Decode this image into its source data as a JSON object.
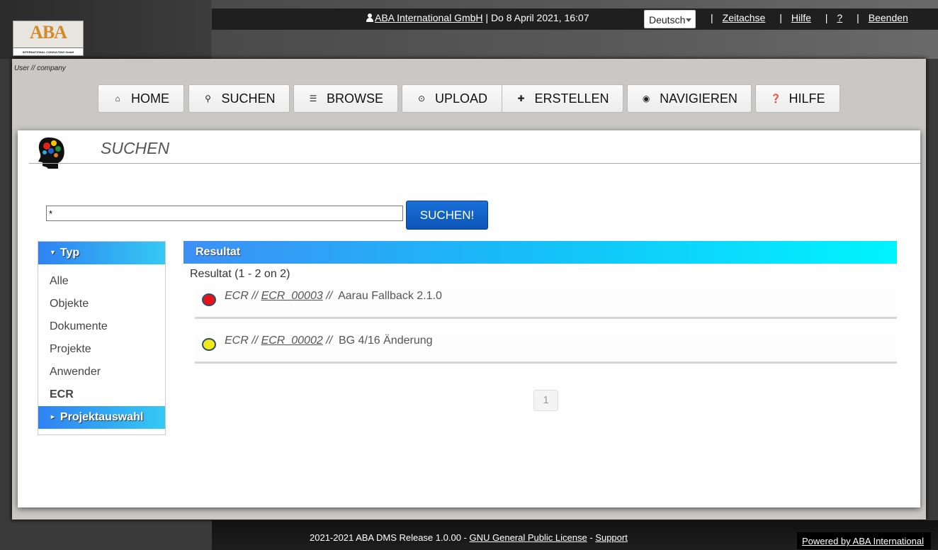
{
  "header": {
    "logo_text": "ABA",
    "logo_sub": "INTERNATIONAL CONSULTING GmbH",
    "user_link": "ABA International GmbH",
    "datetime": "| Do 8 April 2021, 16:07",
    "language": "Deutsch",
    "links": [
      "Zeitachse",
      "Hilfe",
      "?",
      "Beenden"
    ]
  },
  "breadcrumb_user": "User // company",
  "nav": {
    "home": "HOME",
    "search": "SUCHEN",
    "browse": "BROWSE",
    "upload": "UPLOAD",
    "create": "ERSTELLEN",
    "navigate": "NAVIGIEREN",
    "help": "HILFE"
  },
  "page": {
    "title": "SUCHEN",
    "search_value": "*",
    "search_button": "SUCHEN!"
  },
  "sidebar": {
    "header": "Typ",
    "items": [
      "Alle",
      "Objekte",
      "Dokumente",
      "Projekte",
      "Anwender",
      "ECR"
    ],
    "sub_header": "Projektauswahl"
  },
  "results": {
    "header": "Resultat",
    "count": "Resultat (1 - 2 on 2)",
    "rows": [
      {
        "type": "ECR",
        "id": "ECR_00003",
        "title": "Aarau Fallback 2.1.0",
        "status_color": "#e8131a"
      },
      {
        "type": "ECR",
        "id": "ECR_00002",
        "title": "BG 4/16 Änderung",
        "status_color": "#f2ea18"
      }
    ],
    "page": "1"
  },
  "footer": {
    "text": "2021-2021 ABA DMS Release 1.0.00 -",
    "license": "GNU General Public License",
    "dash": "-",
    "support": "Support",
    "powered": "Powered by ABA International"
  },
  "colors": {
    "accent_blue": "#0b56b8",
    "header_gradient_start": "#2f82f2",
    "header_gradient_end": "#00f4ff"
  }
}
